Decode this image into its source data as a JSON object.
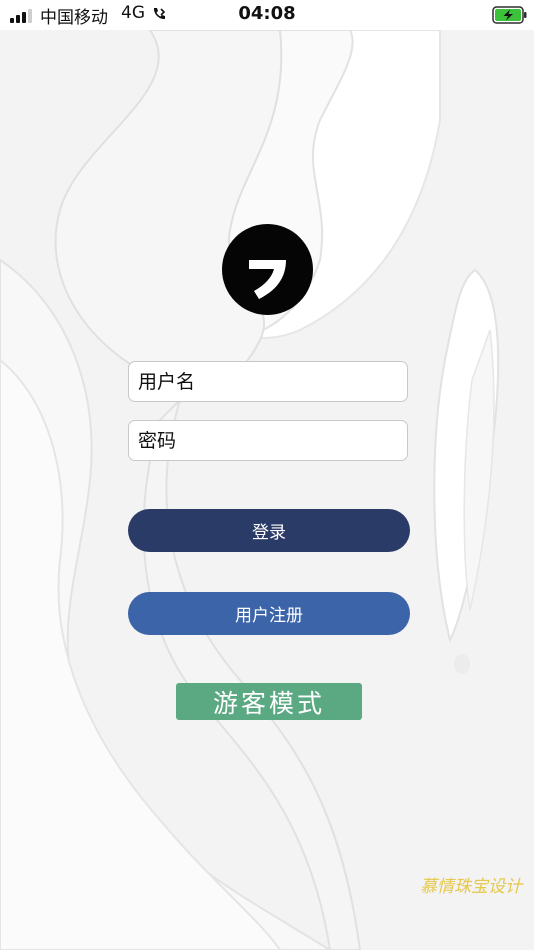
{
  "status_bar": {
    "carrier": "中国移动",
    "network": "4G",
    "time": "04:08",
    "battery_icon": "battery-charging-icon",
    "battery_color": "#3cc13b",
    "call_icon": "phone-forward-icon"
  },
  "logo": {
    "icon": "app-logo-icon"
  },
  "form": {
    "username_placeholder": "用户名",
    "password_placeholder": "密码"
  },
  "buttons": {
    "login": "登录",
    "register": "用户注册",
    "guest": "游客模式"
  },
  "colors": {
    "login_button": "#2b3b67",
    "register_button": "#3c64a8",
    "guest_button": "#5aa983",
    "watermark": "#e5c84a"
  },
  "watermark": "慕情珠宝设计"
}
